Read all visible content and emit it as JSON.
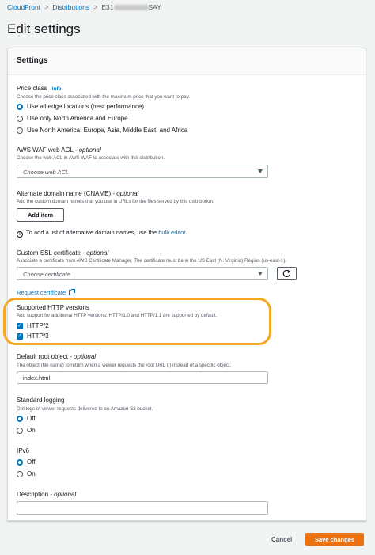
{
  "breadcrumb": {
    "root": "CloudFront",
    "section": "Distributions",
    "current_prefix": "E31",
    "current_suffix": "SAY"
  },
  "page_title": "Edit settings",
  "panel_title": "Settings",
  "price_class": {
    "label": "Price class",
    "info": "Info",
    "desc": "Choose the price class associated with the maximum price that you want to pay.",
    "options": [
      "Use all edge locations (best performance)",
      "Use only North America and Europe",
      "Use North America, Europe, Asia, Middle East, and Africa"
    ],
    "selected": 0
  },
  "waf": {
    "label": "AWS WAF web ACL",
    "optional": "- optional",
    "desc": "Choose the web ACL in AWS WAF to associate with this distribution.",
    "placeholder": "Choose web ACL"
  },
  "cname": {
    "label": "Alternate domain name (CNAME)",
    "optional": "- optional",
    "desc": "Add the custom domain names that you use in URLs for the files served by this distribution.",
    "add_button": "Add item",
    "bulk_prefix": "To add a list of alternative domain names, use the",
    "bulk_link": "bulk editor",
    "bulk_suffix": "."
  },
  "ssl": {
    "label": "Custom SSL certificate",
    "optional": "- optional",
    "desc": "Associate a certificate from AWS Certificate Manager. The certificate must be in the US East (N. Virginia) Region (us-east-1).",
    "placeholder": "Choose certificate",
    "request_link": "Request certificate"
  },
  "http": {
    "label": "Supported HTTP versions",
    "desc": "Add support for additional HTTP versions. HTTP/1.0 and HTTP/1.1 are supported by default.",
    "options": [
      "HTTP/2",
      "HTTP/3"
    ]
  },
  "root_object": {
    "label": "Default root object",
    "optional": "- optional",
    "desc": "The object (file name) to return when a viewer requests the root URL (/) instead of a specific object.",
    "value": "index.html"
  },
  "logging": {
    "label": "Standard logging",
    "desc": "Get logs of viewer requests delivered to an Amazon S3 bucket.",
    "options": [
      "Off",
      "On"
    ],
    "selected": 0
  },
  "ipv6": {
    "label": "IPv6",
    "options": [
      "Off",
      "On"
    ],
    "selected": 0
  },
  "description": {
    "label": "Description",
    "optional": "- optional",
    "value": ""
  },
  "footer": {
    "cancel": "Cancel",
    "save": "Save changes"
  },
  "colors": {
    "accent": "#0073bb",
    "primary_button": "#ec7211",
    "highlight": "#f5a623"
  }
}
